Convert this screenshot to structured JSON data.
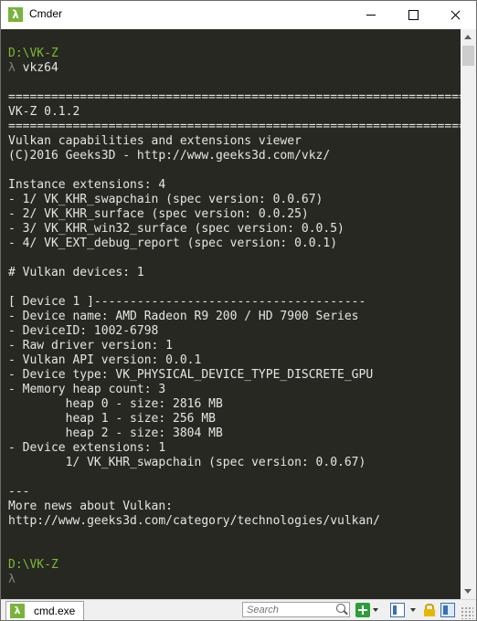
{
  "window": {
    "title": "Cmder",
    "app_icon_glyph": "λ",
    "app_icon_color": "#7ab33c"
  },
  "console": {
    "background": "#272822",
    "text_color": "#e5e5e5",
    "prompt_path_color": "#7cbc32",
    "lines": [
      {
        "text": "D:\\VK-Z",
        "style": "path"
      },
      {
        "text": "λ vkz64",
        "style": "lambda"
      },
      {
        "text": "",
        "style": "normal"
      },
      {
        "text": "=====================================================================",
        "style": "normal"
      },
      {
        "text": "VK-Z 0.1.2",
        "style": "normal"
      },
      {
        "text": "=====================================================================",
        "style": "normal"
      },
      {
        "text": "Vulkan capabilities and extensions viewer",
        "style": "normal"
      },
      {
        "text": "(C)2016 Geeks3D - http://www.geeks3d.com/vkz/",
        "style": "normal"
      },
      {
        "text": "",
        "style": "normal"
      },
      {
        "text": "Instance extensions: 4",
        "style": "normal"
      },
      {
        "text": "- 1/ VK_KHR_swapchain (spec version: 0.0.67)",
        "style": "normal"
      },
      {
        "text": "- 2/ VK_KHR_surface (spec version: 0.0.25)",
        "style": "normal"
      },
      {
        "text": "- 3/ VK_KHR_win32_surface (spec version: 0.0.5)",
        "style": "normal"
      },
      {
        "text": "- 4/ VK_EXT_debug_report (spec version: 0.0.1)",
        "style": "normal"
      },
      {
        "text": "",
        "style": "normal"
      },
      {
        "text": "# Vulkan devices: 1",
        "style": "normal"
      },
      {
        "text": "",
        "style": "normal"
      },
      {
        "text": "[ Device 1 ]--------------------------------------",
        "style": "normal"
      },
      {
        "text": "- Device name: AMD Radeon R9 200 / HD 7900 Series",
        "style": "normal"
      },
      {
        "text": "- DeviceID: 1002-6798",
        "style": "normal"
      },
      {
        "text": "- Raw driver version: 1",
        "style": "normal"
      },
      {
        "text": "- Vulkan API version: 0.0.1",
        "style": "normal"
      },
      {
        "text": "- Device type: VK_PHYSICAL_DEVICE_TYPE_DISCRETE_GPU",
        "style": "normal"
      },
      {
        "text": "- Memory heap count: 3",
        "style": "normal"
      },
      {
        "text": "        heap 0 - size: 2816 MB",
        "style": "normal"
      },
      {
        "text": "        heap 1 - size: 256 MB",
        "style": "normal"
      },
      {
        "text": "        heap 2 - size: 3804 MB",
        "style": "normal"
      },
      {
        "text": "- Device extensions: 1",
        "style": "normal"
      },
      {
        "text": "        1/ VK_KHR_swapchain (spec version: 0.0.67)",
        "style": "normal"
      },
      {
        "text": "",
        "style": "normal"
      },
      {
        "text": "---",
        "style": "normal"
      },
      {
        "text": "More news about Vulkan:",
        "style": "normal"
      },
      {
        "text": "http://www.geeks3d.com/category/technologies/vulkan/",
        "style": "normal"
      },
      {
        "text": "",
        "style": "normal"
      },
      {
        "text": "",
        "style": "normal"
      },
      {
        "text": "D:\\VK-Z",
        "style": "path"
      },
      {
        "text": "λ",
        "style": "lambda"
      }
    ]
  },
  "statusbar": {
    "tab_label": "cmd.exe",
    "tab_icon_glyph": "λ",
    "search_placeholder": "Search"
  }
}
